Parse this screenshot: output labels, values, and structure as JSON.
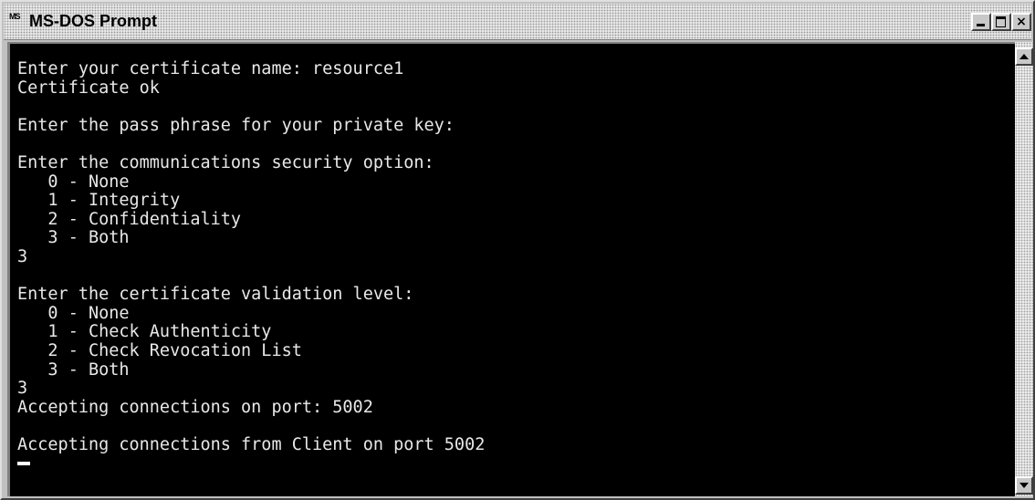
{
  "window": {
    "title": "MS-DOS Prompt",
    "icon_label": "MS"
  },
  "colors": {
    "console_background": "#000000",
    "console_text": "#e8e8e8",
    "titlebar": "#e6e6e6"
  },
  "console": {
    "lines": [
      "Enter your certificate name: resource1",
      "Certificate ok",
      "",
      "Enter the pass phrase for your private key:",
      "",
      "Enter the communications security option:",
      "   0 - None",
      "   1 - Integrity",
      "   2 - Confidentiality",
      "   3 - Both",
      "3",
      "",
      "Enter the certificate validation level:",
      "   0 - None",
      "   1 - Check Authenticity",
      "   2 - Check Revocation List",
      "   3 - Both",
      "3",
      "Accepting connections on port: 5002",
      "",
      "Accepting connections from Client on port 5002"
    ]
  }
}
